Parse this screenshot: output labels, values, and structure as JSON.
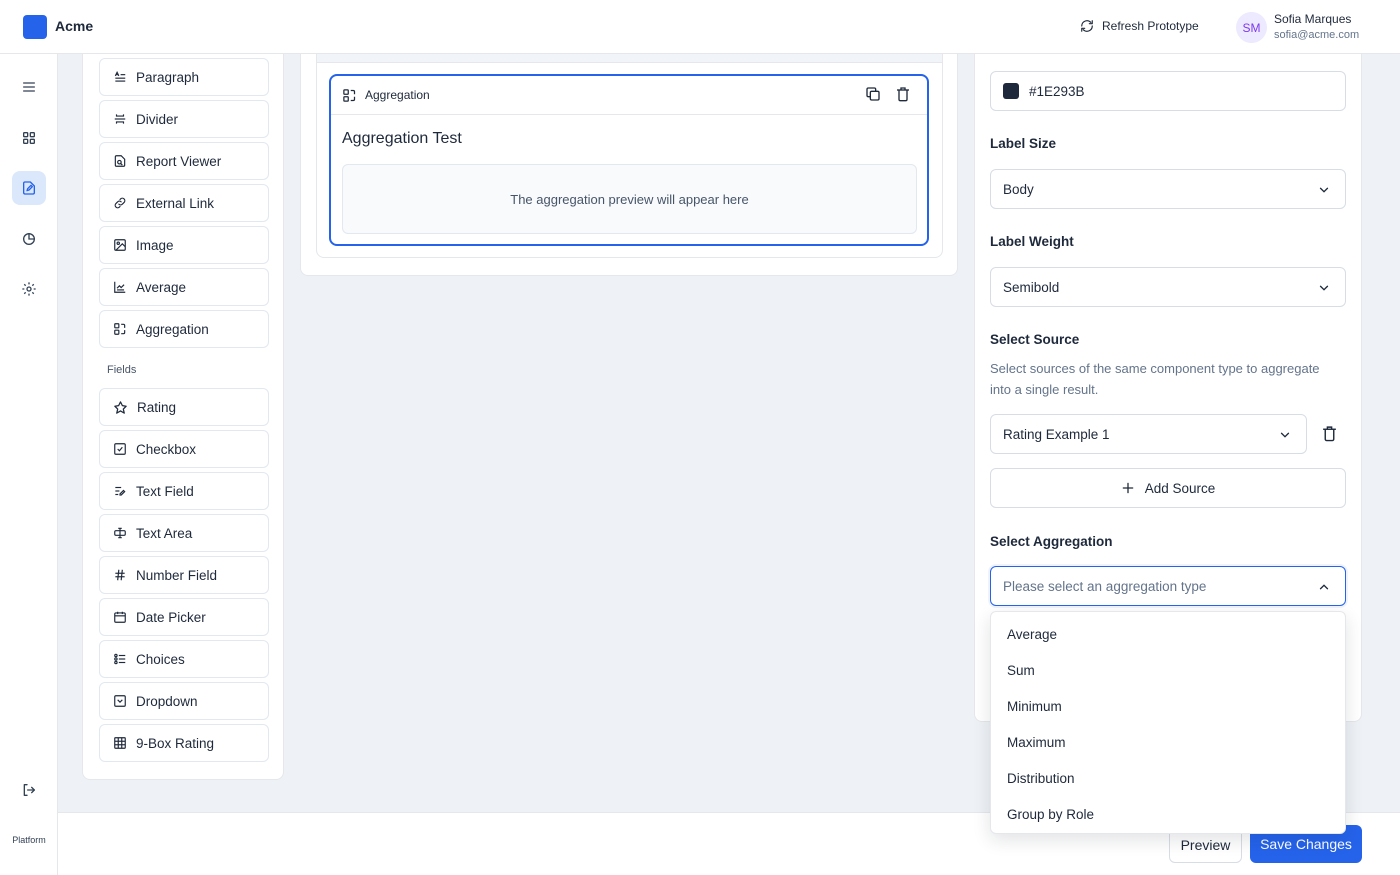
{
  "app": {
    "title": "Acme"
  },
  "header": {
    "refresh_label": "Refresh Prototype",
    "user": {
      "initials": "SM",
      "name": "Sofia Marques",
      "email": "sofia@acme.com"
    }
  },
  "rail": {
    "footer_label": "Platform"
  },
  "palette": {
    "items_top": [
      {
        "label": "Paragraph",
        "icon": "paragraph-icon"
      },
      {
        "label": "Divider",
        "icon": "divider-icon"
      },
      {
        "label": "Report Viewer",
        "icon": "report-viewer-icon"
      },
      {
        "label": "External Link",
        "icon": "link-icon"
      },
      {
        "label": "Image",
        "icon": "image-icon"
      },
      {
        "label": "Average",
        "icon": "average-icon"
      },
      {
        "label": "Aggregation",
        "icon": "aggregation-icon"
      }
    ],
    "fields_heading": "Fields",
    "fields": [
      {
        "label": "Rating",
        "icon": "star-icon"
      },
      {
        "label": "Checkbox",
        "icon": "checkbox-icon"
      },
      {
        "label": "Text Field",
        "icon": "text-field-icon"
      },
      {
        "label": "Text Area",
        "icon": "text-area-icon"
      },
      {
        "label": "Number Field",
        "icon": "hash-icon"
      },
      {
        "label": "Date Picker",
        "icon": "calendar-icon"
      },
      {
        "label": "Choices",
        "icon": "choices-icon"
      },
      {
        "label": "Dropdown",
        "icon": "dropdown-icon"
      },
      {
        "label": "9-Box Rating",
        "icon": "grid-icon"
      }
    ]
  },
  "canvas": {
    "block_type": "Aggregation",
    "block_title": "Aggregation Test",
    "preview_placeholder": "The aggregation preview will appear here"
  },
  "settings": {
    "color_value": "#1E293B",
    "label_size": {
      "label": "Label Size",
      "value": "Body"
    },
    "label_weight": {
      "label": "Label Weight",
      "value": "Semibold"
    },
    "source": {
      "label": "Select Source",
      "help": "Select sources of the same component type to aggregate into a single result.",
      "selected": "Rating Example 1",
      "add_label": "Add Source"
    },
    "aggregation": {
      "label": "Select Aggregation",
      "placeholder": "Please select an aggregation type",
      "options": [
        "Average",
        "Sum",
        "Minimum",
        "Maximum",
        "Distribution",
        "Group by Role"
      ]
    }
  },
  "footer": {
    "preview_label": "Preview",
    "save_label": "Save Changes"
  },
  "colors": {
    "accent": "#2563eb",
    "swatch": "#1E293B"
  }
}
